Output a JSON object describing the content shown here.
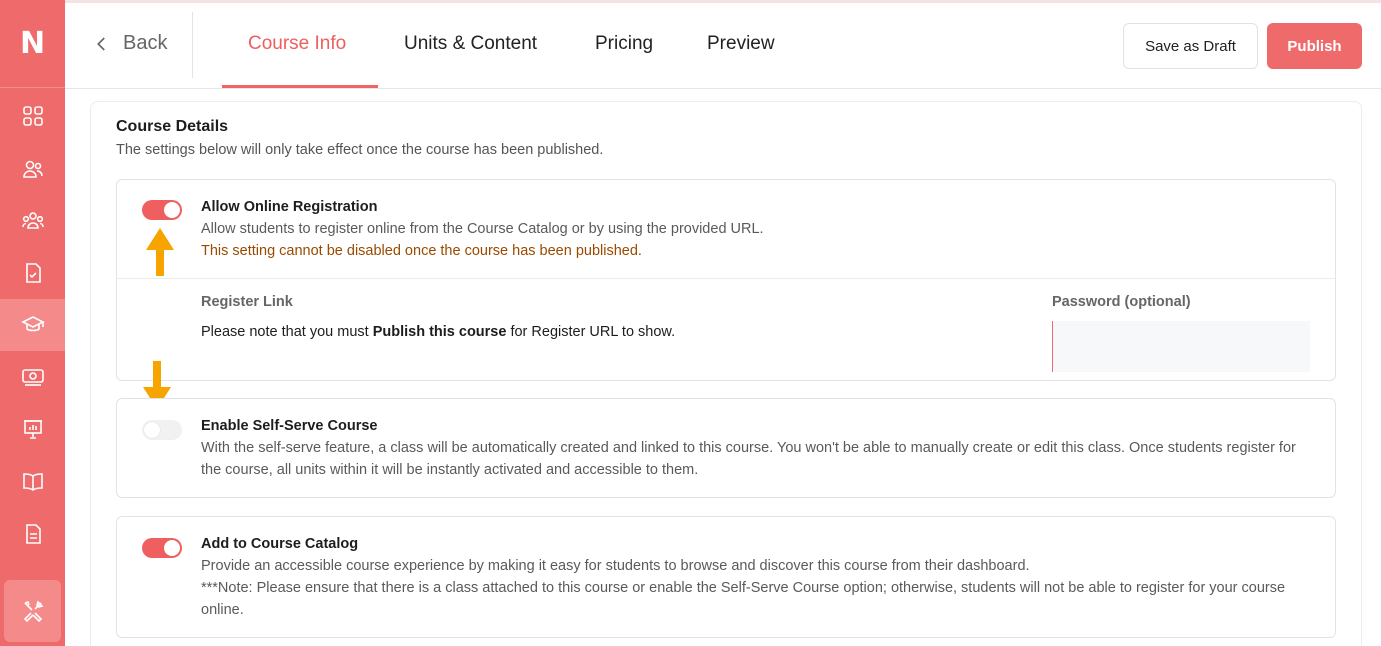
{
  "sidebar": {
    "logo": "N",
    "items": [
      {
        "name": "dashboard-grid-icon"
      },
      {
        "name": "users-icon"
      },
      {
        "name": "groups-icon"
      },
      {
        "name": "assignment-check-icon"
      },
      {
        "name": "graduation-cap-icon",
        "active": true
      },
      {
        "name": "money-icon"
      },
      {
        "name": "presentation-board-icon"
      },
      {
        "name": "book-icon"
      },
      {
        "name": "document-icon"
      },
      {
        "name": "tools-icon"
      }
    ]
  },
  "header": {
    "back_label": "Back",
    "tabs": [
      {
        "label": "Course Info",
        "active": true
      },
      {
        "label": "Units & Content"
      },
      {
        "label": "Pricing"
      },
      {
        "label": "Preview"
      }
    ],
    "save_draft_label": "Save as Draft",
    "publish_label": "Publish"
  },
  "course_details": {
    "title": "Course Details",
    "subtitle": "The settings below will only take effect once the course has been published.",
    "online_registration": {
      "enabled": true,
      "title": "Allow Online Registration",
      "description": "Allow students to register online from the Course Catalog or by using the provided URL.",
      "warning": "This setting cannot be disabled once the course has been published.",
      "register_link_label": "Register Link",
      "note_prefix": "Please note that you must ",
      "note_bold": "Publish this course",
      "note_suffix": " for Register URL to show.",
      "password_label": "Password (optional)",
      "password_value": ""
    },
    "self_serve": {
      "enabled": false,
      "title": "Enable Self-Serve Course",
      "description": "With the self-serve feature, a class will be automatically created and linked to this course. You won't be able to manually create or edit this class. Once students register for the course, all units within it will be instantly activated and accessible to them."
    },
    "catalog": {
      "enabled": true,
      "title": "Add to Course Catalog",
      "description": "Provide an accessible course experience by making it easy for students to browse and discover this course from their dashboard.",
      "note": "***Note: Please ensure that there is a class attached to this course or enable the Self-Serve Course option; otherwise, students will not be able to register for your course online."
    }
  },
  "colors": {
    "accent": "#ef6a6a",
    "annotation_arrow": "#f7a400",
    "warning_text": "#9a4a00"
  }
}
